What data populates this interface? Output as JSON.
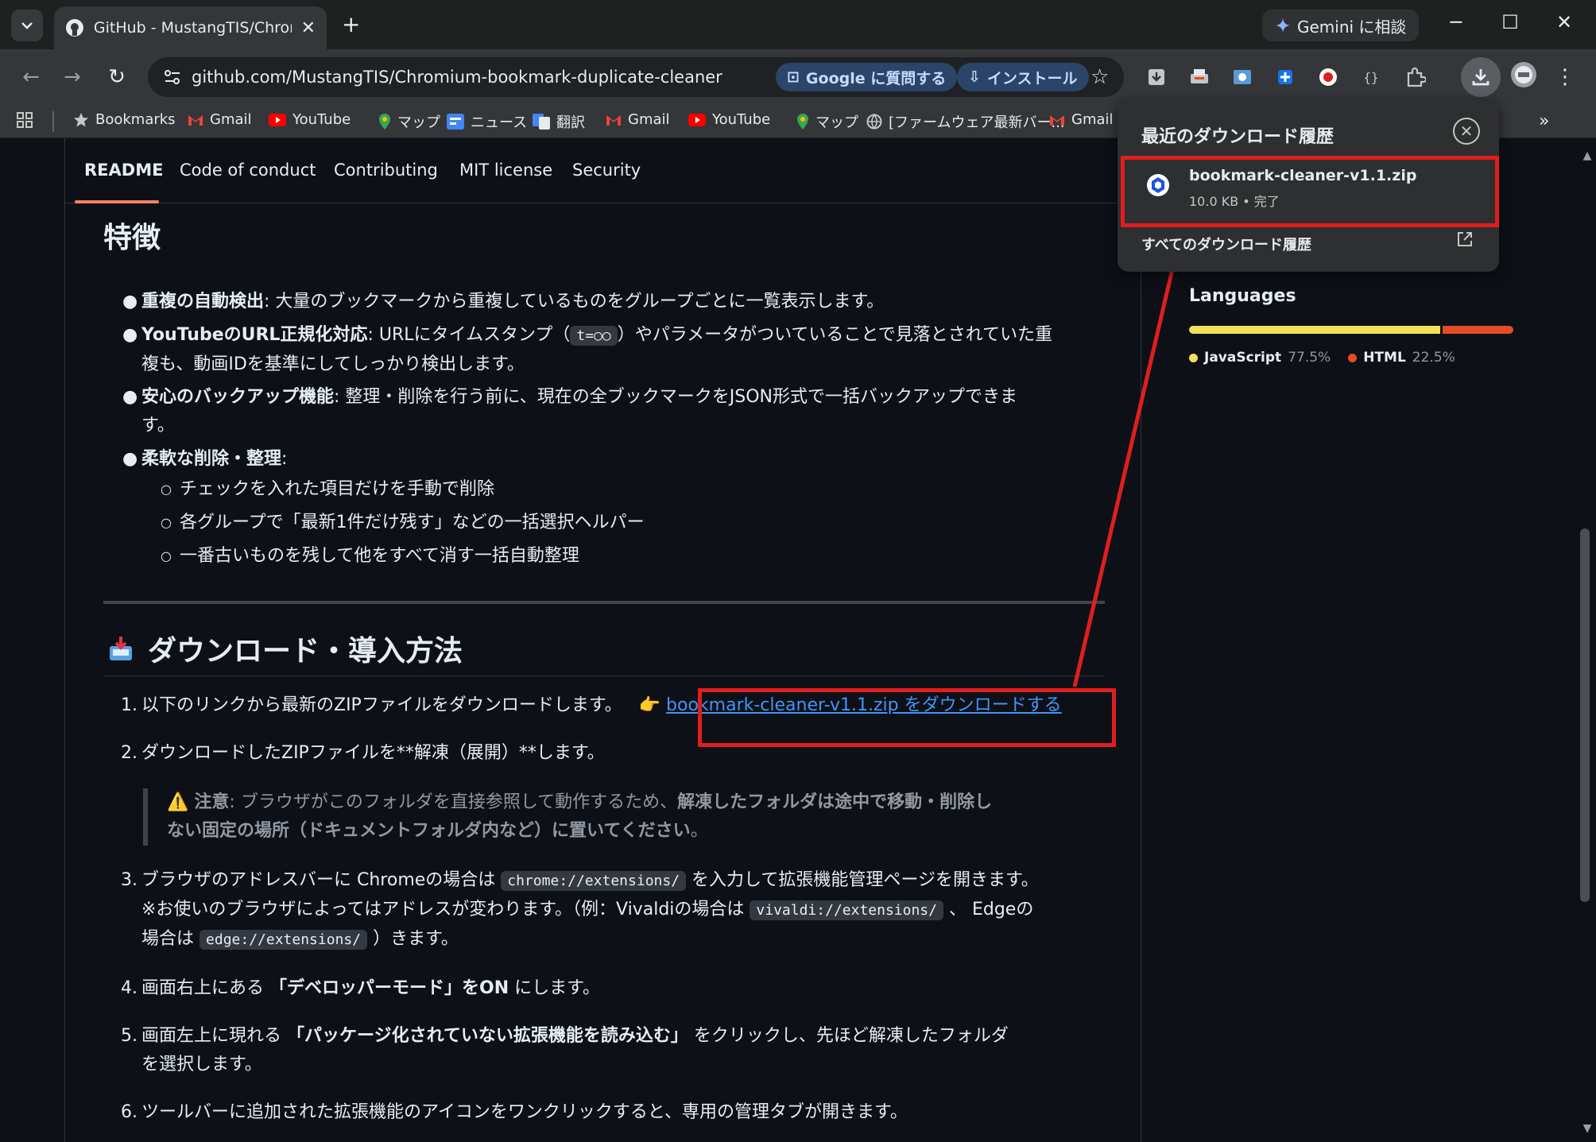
{
  "browser": {
    "tab_title": "GitHub - MustangTIS/Chromium-bookmark-duplicate-cleaner",
    "new_tab": "+",
    "gemini_label": "Gemini に相談",
    "url": "github.com/MustangTIS/Chromium-bookmark-duplicate-cleaner",
    "google_pill": "Google に質問する",
    "install_pill": "インストール",
    "bookmarks": [
      {
        "label": "Bookmarks",
        "icon": "star-icon"
      },
      {
        "label": "Gmail",
        "icon": "gmail-icon"
      },
      {
        "label": "YouTube",
        "icon": "youtube-icon"
      },
      {
        "label": "マップ",
        "icon": "maps-icon"
      },
      {
        "label": "ニュース",
        "icon": "news-icon"
      },
      {
        "label": "翻訳",
        "icon": "translate-icon"
      },
      {
        "label": "Gmail",
        "icon": "gmail-icon"
      },
      {
        "label": "YouTube",
        "icon": "youtube-icon"
      },
      {
        "label": "マップ",
        "icon": "maps-icon"
      },
      {
        "label": "[ファームウェア最新バー...",
        "icon": "globe-icon"
      },
      {
        "label": "Gmail",
        "icon": "gmail-icon"
      }
    ]
  },
  "readme_tabs": [
    "README",
    "Code of conduct",
    "Contributing",
    "MIT license",
    "Security"
  ],
  "features": {
    "heading": "特徴",
    "items": [
      {
        "bold": "重複の自動検出",
        "text": ": 大量のブックマークから重複しているものをグループごとに一覧表示します。"
      },
      {
        "bold": "YouTubeのURL正規化対応",
        "text_a": ": URLにタイムスタンプ（",
        "code": "t=○○",
        "text_b": "）やパラメータがついていることで見落とされていた重",
        "text_c": "複も、動画IDを基準にしてしっかり検出します。"
      },
      {
        "bold": "安心のバックアップ機能",
        "text": ": 整理・削除を行う前に、現在の全ブックマークをJSON形式で一括バックアップできま",
        "text_c": "す。"
      },
      {
        "bold": "柔軟な削除・整理",
        "text": ":"
      }
    ],
    "sub_items": [
      "チェックを入れた項目だけを手動で削除",
      "各グループで「最新1件だけ残す」などの一括選択ヘルパー",
      "一番古いものを残して他をすべて消す一括自動整理"
    ]
  },
  "download": {
    "heading": "ダウンロード・導入方法",
    "step1_text": "以下のリンクから最新のZIPファイルをダウンロードします。",
    "step1_emoji": "👉",
    "step1_link": "bookmark-cleaner-v1.1.zip をダウンロードする",
    "step2": "ダウンロードしたZIPファイルを**解凍（展開）**します。",
    "note_label": "注意",
    "note_text": ": ブラウザがこのフォルダを直接参照して動作するため、",
    "note_bold_a": "解凍したフォルダは途中で移動・削除し",
    "note_bold_b": "ない固定の場所（ドキュメントフォルダ内など）に置いてください",
    "note_end": "。",
    "step3_a": "ブラウザのアドレスバーに Chromeの場合は",
    "step3_code1": "chrome://extensions/",
    "step3_b": "を入力して拡張機能管理ページを開きます。",
    "step3_c": "※お使いのブラウザによってはアドレスが変わります。（例：Vivaldiの場合は",
    "step3_code2": "vivaldi://extensions/",
    "step3_d": "、 Edgeの",
    "step3_e": "場合は",
    "step3_code3": "edge://extensions/",
    "step3_f": "）きます。",
    "step4_a": "画面右上にある",
    "step4_bold": "「デベロッパーモード」をON",
    "step4_b": "にします。",
    "step5_a": "画面左上に現れる",
    "step5_bold": "「パッケージ化されていない拡張機能を読み込む」",
    "step5_b": "をクリックし、先ほど解凍したフォルダ",
    "step5_c": "を選択します。",
    "step6": "ツールバーに追加された拡張機能のアイコンをワンクリックすると、専用の管理タブが開きます。"
  },
  "languages": {
    "title": "Languages",
    "items": [
      {
        "name": "JavaScript",
        "percent": "77.5%",
        "value": 77.5,
        "color": "#f1e05a"
      },
      {
        "name": "HTML",
        "percent": "22.5%",
        "value": 22.5,
        "color": "#e34c26"
      }
    ]
  },
  "download_popup": {
    "title": "最近のダウンロード履歴",
    "file_name": "bookmark-cleaner-v1.1.zip",
    "file_meta": "10.0 KB • 完了",
    "all_history": "すべてのダウンロード履歴"
  },
  "colors": {
    "annotation_red": "#e01e1e",
    "link_blue": "#4493f8",
    "accent_tab": "#f78166"
  }
}
